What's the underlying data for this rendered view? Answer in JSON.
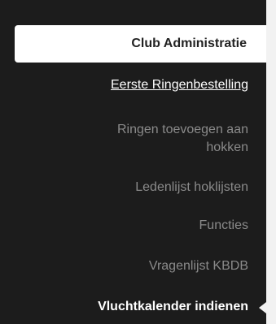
{
  "sidebar": {
    "header": "Club Administratie",
    "items": [
      {
        "label": "Eerste Ringenbestelling",
        "state": "link"
      },
      {
        "label": "Ringen toevoegen aan hokken",
        "line1": "Ringen toevoegen aan",
        "line2": "hokken",
        "state": "normal"
      },
      {
        "label": "Ledenlijst hoklijsten",
        "state": "normal"
      },
      {
        "label": "Functies",
        "state": "normal"
      },
      {
        "label": "Vragenlijst KBDB",
        "state": "normal"
      },
      {
        "label": "Vluchtkalender indienen",
        "state": "active"
      }
    ]
  },
  "colors": {
    "background": "#1c1c1c",
    "text_muted": "#8a8a8a",
    "text_active": "#ffffff",
    "header_bg": "#ffffff",
    "content_bg": "#f2f2f2"
  },
  "icons": {
    "active_indicator": "caret-left-icon"
  }
}
